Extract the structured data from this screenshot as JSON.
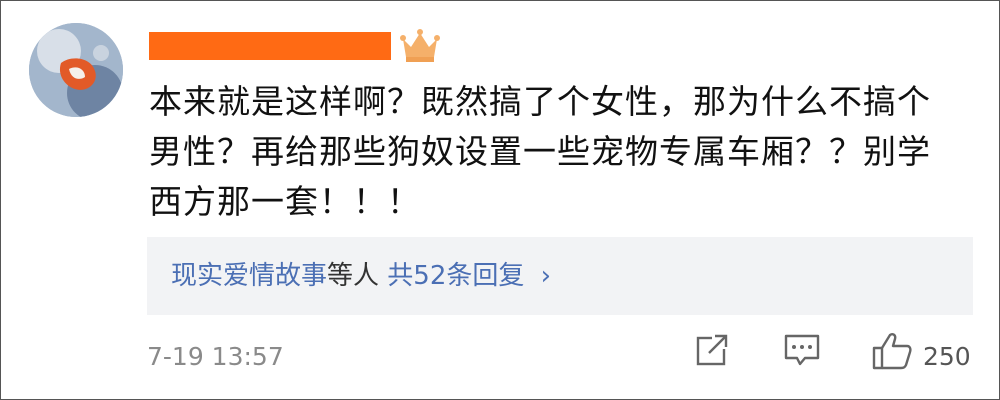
{
  "comment": {
    "text": "本来就是这样啊？既然搞了个女性，那为什么不搞个\n男性？再给那些狗奴设置一些宠物专属车厢？？别学\n西方那一套！！！"
  },
  "replies": {
    "names": "现实爱情故事等人",
    "count_label": "共52条回复",
    "chevron": "›"
  },
  "footer": {
    "timestamp": "7-19 13:57",
    "like_count": "250"
  },
  "icons": {
    "share": "share-icon",
    "comment": "comment-icon",
    "like": "thumbs-up-icon",
    "badge": "crown-icon"
  },
  "colors": {
    "username_redaction": "#ff6a14",
    "link_blue": "#4b6fb4",
    "reply_bg": "#f2f3f5",
    "meta_gray": "#8a8a8a"
  }
}
